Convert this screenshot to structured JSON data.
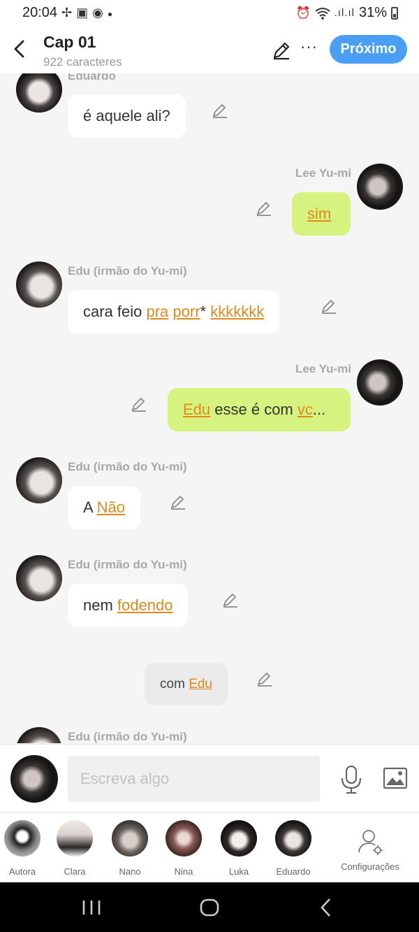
{
  "status_bar": {
    "time": "20:04",
    "left_icons": [
      "fan-icon",
      "gallery-icon",
      "ball-icon",
      "dot-icon"
    ],
    "right_icons": [
      "alarm-icon",
      "wifi-icon",
      "signal-icon"
    ],
    "battery": "31%"
  },
  "header": {
    "title": "Cap 01",
    "subtitle": "922 caracteres",
    "next_label": "Próximo"
  },
  "messages": [
    {
      "speaker": "Eduardo",
      "side": "left",
      "parts": [
        {
          "t": "é aquele ali?",
          "hl": false
        }
      ]
    },
    {
      "speaker": "Lee Yu-mi",
      "side": "right",
      "parts": [
        {
          "t": "sim",
          "hl": true
        }
      ]
    },
    {
      "speaker": "Edu (irmão do Yu-mi)",
      "side": "left",
      "parts": [
        {
          "t": "cara feio ",
          "hl": false
        },
        {
          "t": "pra",
          "hl": true
        },
        {
          "t": " ",
          "hl": false
        },
        {
          "t": "porr",
          "hl": true
        },
        {
          "t": "* ",
          "hl": false
        },
        {
          "t": "kkkkkkk",
          "hl": true
        }
      ]
    },
    {
      "speaker": "Lee Yu-mi",
      "side": "right",
      "parts": [
        {
          "t": "Edu",
          "hl": true
        },
        {
          "t": " esse é com ",
          "hl": false
        },
        {
          "t": "vc",
          "hl": true
        },
        {
          "t": "...",
          "hl": false
        }
      ]
    },
    {
      "speaker": "Edu (irmão do Yu-mi)",
      "side": "left",
      "parts": [
        {
          "t": "A ",
          "hl": false
        },
        {
          "t": "Não",
          "hl": true
        }
      ]
    },
    {
      "speaker": "Edu (irmão do Yu-mi)",
      "side": "left",
      "parts": [
        {
          "t": "nem ",
          "hl": false
        },
        {
          "t": "fodendo",
          "hl": true
        }
      ]
    },
    {
      "speaker": "",
      "side": "center",
      "parts": [
        {
          "t": "com ",
          "hl": false
        },
        {
          "t": "Edu",
          "hl": true
        }
      ]
    },
    {
      "speaker": "Edu (irmão do Yu-mi)",
      "side": "left",
      "parts": []
    }
  ],
  "composer": {
    "placeholder": "Escreva algo"
  },
  "characters": [
    {
      "name": "Autora"
    },
    {
      "name": "Clara"
    },
    {
      "name": "Nano"
    },
    {
      "name": "Nina"
    },
    {
      "name": "Luka"
    },
    {
      "name": "Eduardo"
    }
  ],
  "settings_label": "Configurações",
  "colors": {
    "accent": "#4a9ff5",
    "right_bubble": "#d5f37e",
    "highlight": "#e08a1c"
  }
}
